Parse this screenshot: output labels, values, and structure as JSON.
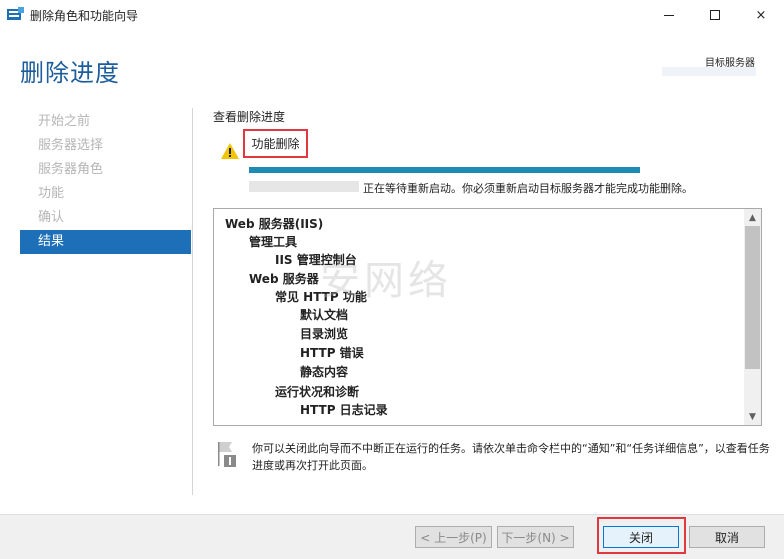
{
  "window": {
    "title": "删除角色和功能向导",
    "controls": {
      "minimize": "minimize",
      "maximize": "maximize",
      "close": "×"
    }
  },
  "header": {
    "page_title": "删除进度",
    "target_server_label": "目标服务器"
  },
  "nav": {
    "items": [
      {
        "label": "开始之前",
        "active": false
      },
      {
        "label": "服务器选择",
        "active": false
      },
      {
        "label": "服务器角色",
        "active": false
      },
      {
        "label": "功能",
        "active": false
      },
      {
        "label": "确认",
        "active": false
      },
      {
        "label": "结果",
        "active": true
      }
    ]
  },
  "content": {
    "section_label": "查看删除进度",
    "feature_removal_label": "功能删除",
    "progress_fraction": 1.0,
    "restart_message": "正在等待重新启动。你必须重新启动目标服务器才能完成功能删除。",
    "tree": [
      {
        "text": "Web 服务器(IIS)",
        "level": 0
      },
      {
        "text": "管理工具",
        "level": 1
      },
      {
        "text": "IIS 管理控制台",
        "level": 2
      },
      {
        "text": "Web 服务器",
        "level": 1
      },
      {
        "text": "常见 HTTP 功能",
        "level": 2
      },
      {
        "text": "默认文档",
        "level": 3
      },
      {
        "text": "目录浏览",
        "level": 3
      },
      {
        "text": "HTTP 错误",
        "level": 3
      },
      {
        "text": "静态内容",
        "level": 3
      },
      {
        "text": "运行状况和诊断",
        "level": 2
      },
      {
        "text": "HTTP 日志记录",
        "level": 3
      }
    ],
    "watermark": "安网络",
    "info_note": "你可以关闭此向导而不中断正在运行的任务。请依次单击命令栏中的“通知”和“任务详细信息”，以查看任务进度或再次打开此页面。"
  },
  "footer": {
    "prev_label": "< 上一步(P)",
    "next_label": "下一步(N) >",
    "close_label": "关闭",
    "cancel_label": "取消"
  },
  "colors": {
    "accent": "#1d6fb8",
    "title": "#1d5d9b",
    "progress": "#1f8ab3",
    "highlight": "#e0383e"
  }
}
